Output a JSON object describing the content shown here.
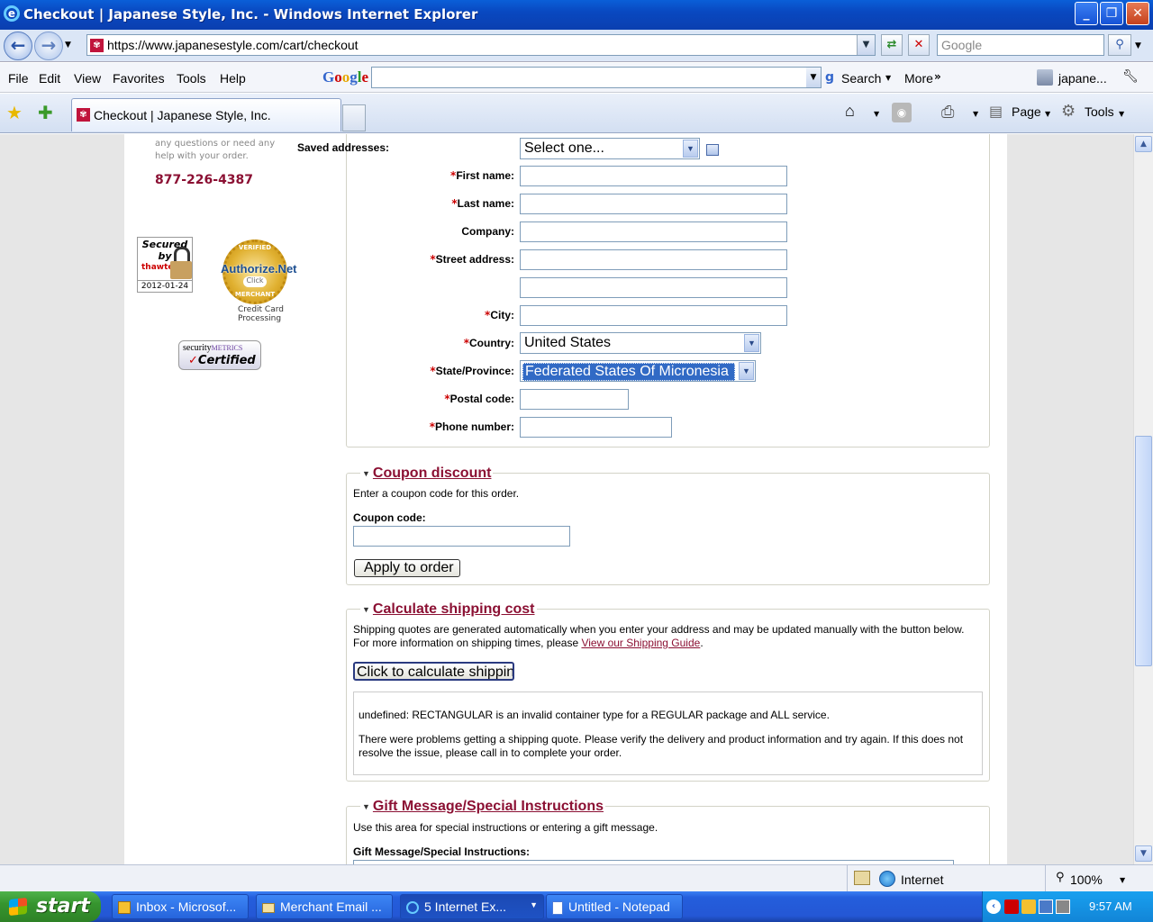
{
  "window": {
    "title": "Checkout | Japanese Style, Inc. - Windows Internet Explorer",
    "minimize": "_",
    "maximize": "❐",
    "close": "✕"
  },
  "addressbar": {
    "url": "https://www.japanesestyle.com/cart/checkout",
    "search_placeholder": "Google"
  },
  "menubar": {
    "items": [
      "File",
      "Edit",
      "View",
      "Favorites",
      "Tools",
      "Help"
    ],
    "google_logo": "Google",
    "search_label": "Search",
    "more_label": "More",
    "profile_label": "japane..."
  },
  "tabs": {
    "active_tab": "Checkout | Japanese Style, Inc.",
    "page_label": "Page",
    "tools_label": "Tools"
  },
  "sidebar": {
    "help_text_line1": "any questions or need any",
    "help_text_line2": "help with your order.",
    "phone": "877-226-4387",
    "thawte_line1": "Secured",
    "thawte_line2": "by",
    "thawte_brand": "thawte",
    "thawte_date": "2012-01-24",
    "authorize_brand": "Authorize.Net",
    "authorize_caption1": "Credit Card",
    "authorize_caption2": "Processing",
    "authorize_ring_top": "VERIFIED",
    "authorize_ring_bottom": "MERCHANT",
    "authorize_click": "Click",
    "security_line1": "security",
    "security_line1b": "METRICS",
    "security_line2": "Certified"
  },
  "address_form": {
    "saved_addresses_label": "Saved addresses:",
    "saved_addresses_value": "Select one...",
    "first_name_label": "First name:",
    "last_name_label": "Last name:",
    "company_label": "Company:",
    "street_label": "Street address:",
    "city_label": "City:",
    "country_label": "Country:",
    "country_value": "United States",
    "state_label": "State/Province:",
    "state_value": "Federated States Of Micronesia",
    "postal_label": "Postal code:",
    "phone_label": "Phone number:",
    "required_mark": "*"
  },
  "coupon": {
    "legend": "Coupon discount",
    "description": "Enter a coupon code for this order.",
    "code_label": "Coupon code:",
    "apply_button": "Apply to order"
  },
  "shipping": {
    "legend": "Calculate shipping cost",
    "description_line1": "Shipping quotes are generated automatically when you enter your address and may be updated manually with the button below.",
    "description_line2_prefix": "For more information on shipping times, please ",
    "guide_link": "View our Shipping Guide",
    "description_line2_suffix": ".",
    "calc_button": "Click to calculate shipping",
    "error_line": "undefined: RECTANGULAR is an invalid container type for a REGULAR package and ALL service.",
    "problem_line1": "There were problems getting a shipping quote. Please verify the delivery and product information and try again. If this does not",
    "problem_line2": "resolve the issue, please call in to complete your order."
  },
  "gift": {
    "legend": "Gift Message/Special Instructions",
    "description": "Use this area for special instructions or entering a gift message.",
    "field_label": "Gift Message/Special Instructions:"
  },
  "statusbar": {
    "zone": "Internet",
    "zoom": "100%"
  },
  "taskbar": {
    "start": "start",
    "tasks": [
      "Inbox - Microsof...",
      "Merchant Email ...",
      "5 Internet Ex...",
      "Untitled - Notepad"
    ],
    "clock": "9:57 AM"
  },
  "colors": {
    "accent": "#8b1033",
    "titlebar": "#0a4fcc",
    "taskbar": "#245edc"
  }
}
